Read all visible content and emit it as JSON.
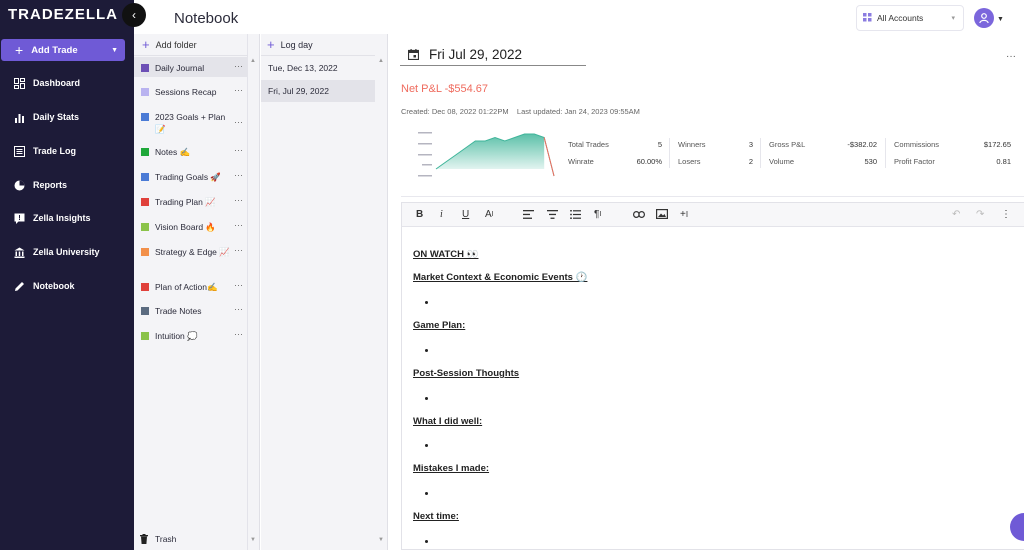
{
  "sidebar": {
    "logo_text": "TRADEZELLA",
    "add_trade_label": "Add Trade",
    "items": [
      {
        "label": "Dashboard",
        "icon": "dashboard-icon"
      },
      {
        "label": "Daily Stats",
        "icon": "bar-chart-icon"
      },
      {
        "label": "Trade Log",
        "icon": "list-icon"
      },
      {
        "label": "Reports",
        "icon": "pie-chart-icon"
      },
      {
        "label": "Zella Insights",
        "icon": "insights-icon"
      },
      {
        "label": "Zella University",
        "icon": "university-icon"
      },
      {
        "label": "Notebook",
        "icon": "pencil-icon"
      }
    ]
  },
  "header": {
    "title": "Notebook",
    "accounts_label": "All Accounts"
  },
  "folders": {
    "add_label": "Add folder",
    "items": [
      {
        "label": "Daily Journal",
        "color": "#6c4fb5"
      },
      {
        "label": "Sessions Recap",
        "color": "#b9b3f0"
      },
      {
        "label": "2023 Goals + Plan 📝",
        "color": "#4b7bd6"
      },
      {
        "label": "Notes ✍️",
        "color": "#1fa83a"
      },
      {
        "label": "Trading Goals 🚀",
        "color": "#4b7bd6"
      },
      {
        "label": "Trading Plan 📈",
        "color": "#e0413b"
      },
      {
        "label": "Vision Board 🔥",
        "color": "#8bc34a"
      },
      {
        "label": "Strategy & Edge 📈",
        "color": "#f2904a"
      },
      {
        "label": "Plan of Action✍️",
        "color": "#e0413b"
      },
      {
        "label": "Trade Notes",
        "color": "#5b6b80"
      },
      {
        "label": "Intuition 💭",
        "color": "#8bc34a"
      }
    ],
    "trash_label": "Trash"
  },
  "days": {
    "add_label": "Log day",
    "items": [
      "Tue, Dec 13, 2022",
      "Fri, Jul 29, 2022"
    ]
  },
  "note": {
    "date": "Fri Jul 29, 2022",
    "net_pl": "Net P&L -$554.67",
    "meta": "Created: Dec 08, 2022 01:22PM    Last updated: Jan 24, 2023 09:55AM",
    "stats": {
      "total_trades_label": "Total Trades",
      "total_trades": "5",
      "winrate_label": "Winrate",
      "winrate": "60.00%",
      "winners_label": "Winners",
      "winners": "3",
      "losers_label": "Losers",
      "losers": "2",
      "gross_pl_label": "Gross P&L",
      "gross_pl": "-$382.02",
      "volume_label": "Volume",
      "volume": "530",
      "commissions_label": "Commissions",
      "commissions": "$172.65",
      "profit_factor_label": "Profit Factor",
      "profit_factor": "0.81"
    },
    "sections": [
      "ON WATCH 👀",
      "Market Context & Economic Events 🕐",
      "Game Plan:",
      "Post-Session Thoughts",
      "What I did well:",
      "Mistakes I made:",
      "Next time:"
    ]
  },
  "chart_data": {
    "type": "area",
    "values": [
      0,
      2,
      4,
      6,
      8,
      8,
      9,
      8,
      9,
      10,
      10,
      9,
      -2
    ],
    "color": "#3fb59a"
  },
  "colors": {
    "sidebar_bg": "#1d1b38",
    "accent": "#6f5ad6",
    "loss": "#ef6b5e"
  }
}
